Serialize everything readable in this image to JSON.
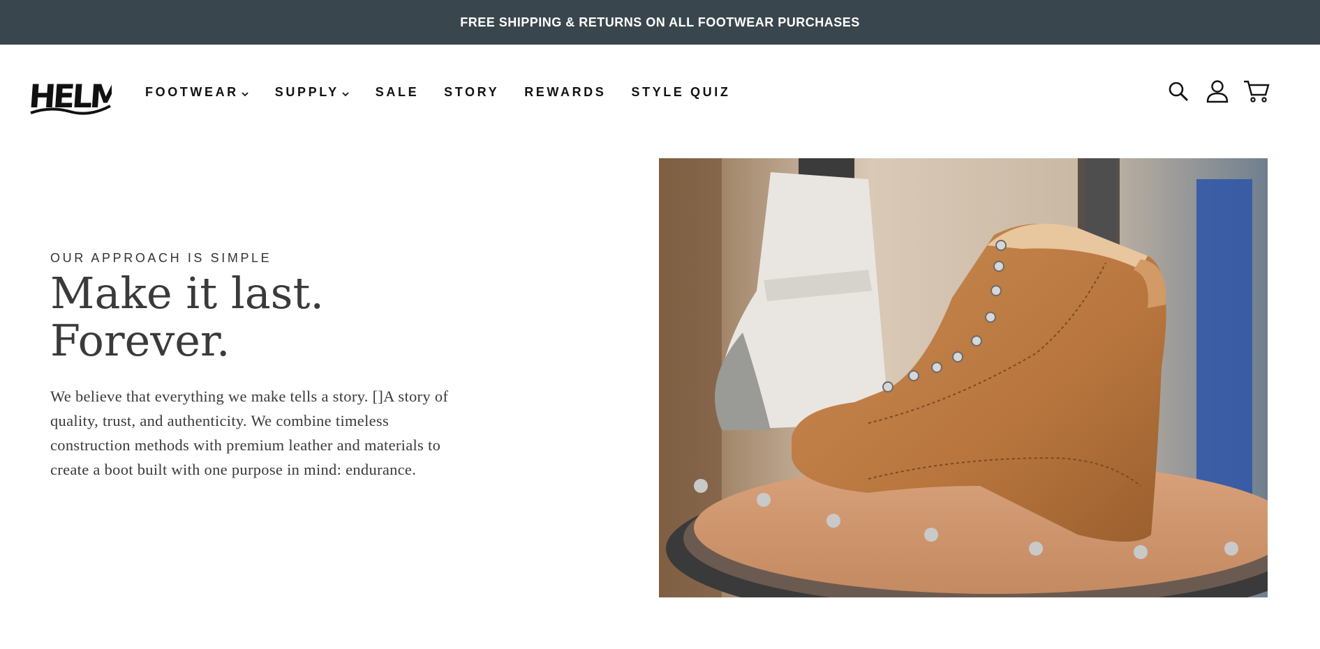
{
  "announcement": {
    "text": "FREE SHIPPING & RETURNS ON ALL FOOTWEAR PURCHASES"
  },
  "header": {
    "logo_text": "HELM",
    "nav": [
      {
        "label": "FOOTWEAR",
        "has_dropdown": true
      },
      {
        "label": "SUPPLY",
        "has_dropdown": true
      },
      {
        "label": "SALE",
        "has_dropdown": false
      },
      {
        "label": "STORY",
        "has_dropdown": false
      },
      {
        "label": "REWARDS",
        "has_dropdown": false
      },
      {
        "label": "STYLE QUIZ",
        "has_dropdown": false
      }
    ],
    "icons": [
      "search-icon",
      "account-icon",
      "cart-icon"
    ]
  },
  "hero": {
    "eyebrow": "OUR APPROACH IS SIMPLE",
    "headline_line1": "Make it last.",
    "headline_line2": "Forever.",
    "body": "We believe that everything we make tells a story. []A story of quality, trust, and authenticity. We combine timeless construction methods with premium leather and materials to create a boot built with one purpose in mind: endurance."
  },
  "colors": {
    "announcement_bg": "#3a464e",
    "text_dark": "#3a3a3a",
    "leather": "#c0824a"
  }
}
